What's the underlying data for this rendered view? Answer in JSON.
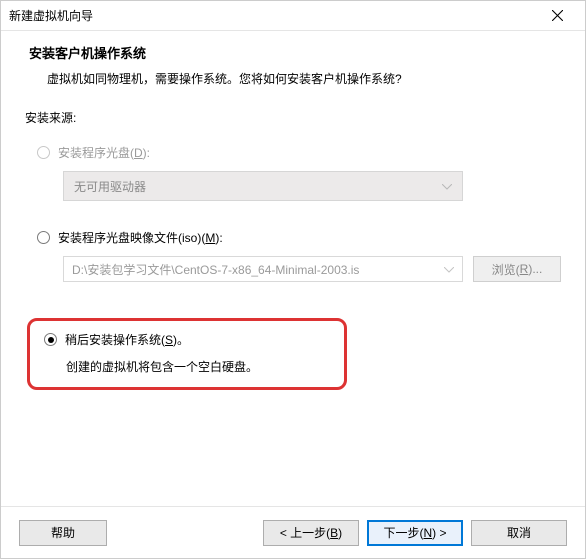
{
  "window": {
    "title": "新建虚拟机向导"
  },
  "header": {
    "title": "安装客户机操作系统",
    "desc": "虚拟机如同物理机，需要操作系统。您将如何安装客户机操作系统?"
  },
  "body": {
    "source_label": "安装来源:",
    "opt_disc": {
      "label_pre": "安装程序光盘(",
      "accel": "D",
      "label_post": "):",
      "dropdown_text": "无可用驱动器"
    },
    "opt_iso": {
      "label_pre": "安装程序光盘映像文件(iso)(",
      "accel": "M",
      "label_post": "):",
      "path": "D:\\安装包学习文件\\CentOS-7-x86_64-Minimal-2003.is",
      "browse_pre": "浏览(",
      "browse_accel": "R",
      "browse_post": ")..."
    },
    "opt_later": {
      "label_pre": "稍后安装操作系统(",
      "accel": "S",
      "label_post": ")。",
      "desc": "创建的虚拟机将包含一个空白硬盘。"
    }
  },
  "footer": {
    "help": "帮助",
    "back_pre": "< 上一步(",
    "back_accel": "B",
    "back_post": ")",
    "next_pre": "下一步(",
    "next_accel": "N",
    "next_post": ") >",
    "cancel": "取消"
  }
}
